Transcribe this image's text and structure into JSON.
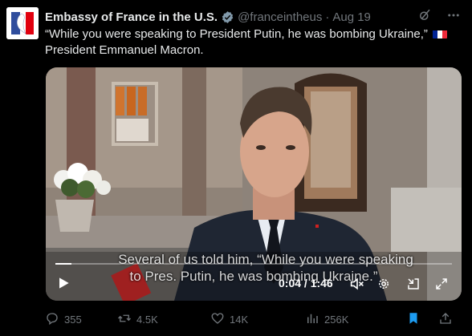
{
  "account": {
    "name": "Embassy of France in the U.S.",
    "handle": "@franceintheus",
    "separator": "·",
    "date": "Aug 19"
  },
  "tweet": {
    "text": "“While you were speaking to President Putin, he was bombing Ukraine,”",
    "text_line2": "President Emmanuel Macron."
  },
  "video": {
    "subtitle_line1": "Several of us told him, “While you were speaking",
    "subtitle_line2": "to Pres. Putin, he was bombing Ukraine.”",
    "time": "0:04 / 1:46",
    "progress": 0.04
  },
  "actions": {
    "replies": "355",
    "reposts": "4.5K",
    "likes": "14K",
    "views": "256K"
  },
  "colors": {
    "background": "#000000",
    "muted": "#71767b",
    "verified": "#829aab",
    "bookmark_active": "#1d9bf0",
    "flag_blue": "#002395",
    "flag_red": "#ed2939"
  },
  "icons": [
    "gold-check-icon",
    "grok-icon",
    "more-icon",
    "play-icon",
    "mute-icon",
    "settings-icon",
    "minimize-icon",
    "fullscreen-icon",
    "reply-icon",
    "repost-icon",
    "like-icon",
    "views-icon",
    "bookmark-icon",
    "share-icon"
  ]
}
